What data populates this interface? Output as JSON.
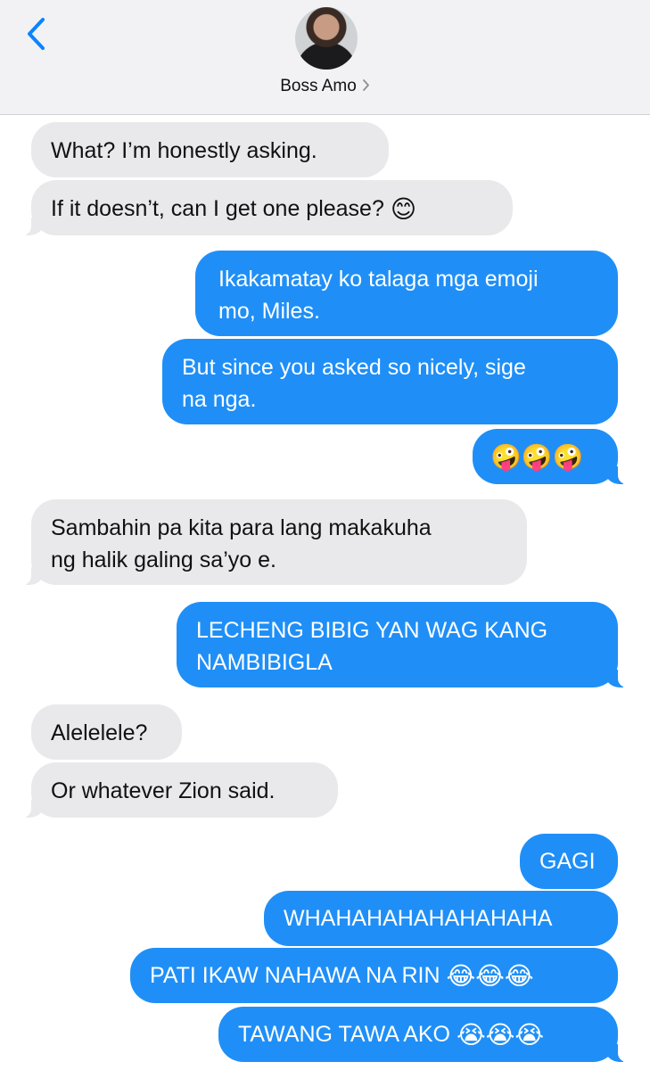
{
  "header": {
    "contact_name": "Boss Amo",
    "back_icon": "chevron-left-icon",
    "accent_color": "#0a84ff"
  },
  "messages": [
    {
      "side": "incoming",
      "text": "What? I’m honestly asking."
    },
    {
      "side": "incoming",
      "text": "If it doesn’t, can I get one please?",
      "emoji": "😊"
    },
    {
      "side": "outgoing",
      "lines": [
        "Ikakamatay ko talaga mga emoji",
        "mo, Miles."
      ]
    },
    {
      "side": "outgoing",
      "lines": [
        "But since you asked so nicely, sige",
        "na nga."
      ]
    },
    {
      "side": "outgoing",
      "emoji": "🤪🤪🤪"
    },
    {
      "side": "incoming",
      "lines": [
        "Sambahin pa kita para lang makakuha",
        "ng halik galing sa’yo e."
      ]
    },
    {
      "side": "outgoing",
      "lines": [
        "LECHENG BIBIG YAN WAG KANG",
        "NAMBIBIGLA"
      ]
    },
    {
      "side": "incoming",
      "text": "Alelelele?"
    },
    {
      "side": "incoming",
      "text": "Or whatever Zion said."
    },
    {
      "side": "outgoing",
      "text": "GAGI"
    },
    {
      "side": "outgoing",
      "text": "WHAHAHAHAHAHAHAHA"
    },
    {
      "side": "outgoing",
      "text": "PATI IKAW NAHAWA NA RIN",
      "emoji": "😂😂😂"
    },
    {
      "side": "outgoing",
      "text": "TAWANG TAWA AKO",
      "emoji": "😭😭😭"
    }
  ],
  "colors": {
    "incoming_bubble": "#e9e9eb",
    "outgoing_bubble": "#1f8ff7",
    "header_bg": "#f2f2f4"
  }
}
